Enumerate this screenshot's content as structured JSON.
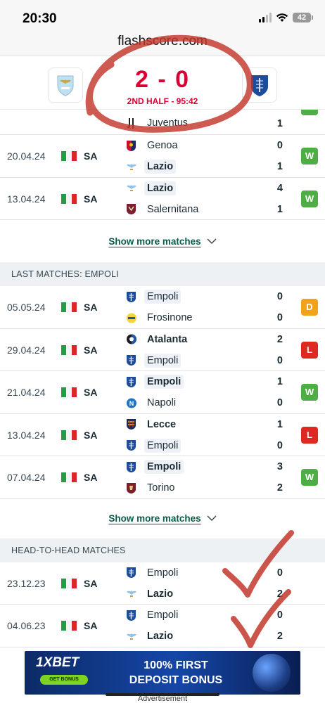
{
  "status_bar": {
    "time": "20:30",
    "battery": "42"
  },
  "browser": {
    "url": "flashscore.com"
  },
  "header": {
    "score": "2 - 0",
    "status": "2ND HALF - 95:42",
    "home_team": "lazio-crest",
    "away_team": "empoli-crest"
  },
  "lazio_matches": {
    "partial": {
      "home": "Juventus",
      "home_goals": "1",
      "result": "W"
    },
    "rows": [
      {
        "date": "20.04.24",
        "comp": "SA",
        "home": "Genoa",
        "away": "Lazio",
        "home_goals": "0",
        "away_goals": "1",
        "result": "W",
        "bold": "away",
        "hl": "away",
        "home_icon": "genoa",
        "away_icon": "lazio"
      },
      {
        "date": "13.04.24",
        "comp": "SA",
        "home": "Lazio",
        "away": "Salernitana",
        "home_goals": "4",
        "away_goals": "1",
        "result": "W",
        "bold": "home",
        "hl": "home",
        "home_icon": "lazio",
        "away_icon": "salernitana"
      }
    ],
    "show_more": "Show more matches"
  },
  "empoli_section": {
    "title": "LAST MATCHES: EMPOLI",
    "rows": [
      {
        "date": "05.05.24",
        "comp": "SA",
        "home": "Empoli",
        "away": "Frosinone",
        "home_goals": "0",
        "away_goals": "0",
        "result": "D",
        "bold": "none",
        "hl": "home",
        "home_icon": "empoli",
        "away_icon": "frosinone"
      },
      {
        "date": "29.04.24",
        "comp": "SA",
        "home": "Atalanta",
        "away": "Empoli",
        "home_goals": "2",
        "away_goals": "0",
        "result": "L",
        "bold": "home",
        "hl": "away",
        "home_icon": "atalanta",
        "away_icon": "empoli"
      },
      {
        "date": "21.04.24",
        "comp": "SA",
        "home": "Empoli",
        "away": "Napoli",
        "home_goals": "1",
        "away_goals": "0",
        "result": "W",
        "bold": "home",
        "hl": "home",
        "home_icon": "empoli",
        "away_icon": "napoli"
      },
      {
        "date": "13.04.24",
        "comp": "SA",
        "home": "Lecce",
        "away": "Empoli",
        "home_goals": "1",
        "away_goals": "0",
        "result": "L",
        "bold": "home",
        "hl": "away",
        "home_icon": "lecce",
        "away_icon": "empoli"
      },
      {
        "date": "07.04.24",
        "comp": "SA",
        "home": "Empoli",
        "away": "Torino",
        "home_goals": "3",
        "away_goals": "2",
        "result": "W",
        "bold": "home",
        "hl": "home",
        "home_icon": "empoli",
        "away_icon": "torino"
      }
    ],
    "show_more": "Show more matches"
  },
  "h2h_section": {
    "title": "HEAD-TO-HEAD MATCHES",
    "rows": [
      {
        "date": "23.12.23",
        "comp": "SA",
        "home": "Empoli",
        "away": "Lazio",
        "home_goals": "0",
        "away_goals": "2",
        "result": "",
        "bold": "away",
        "hl": "none",
        "home_icon": "empoli",
        "away_icon": "lazio"
      },
      {
        "date": "04.06.23",
        "comp": "SA",
        "home": "Empoli",
        "away": "Lazio",
        "home_goals": "0",
        "away_goals": "2",
        "result": "",
        "bold": "away",
        "hl": "none",
        "home_icon": "empoli",
        "away_icon": "lazio"
      }
    ]
  },
  "ad": {
    "brand": "1XBET",
    "cta": "GET BONUS",
    "line1": "100% FIRST",
    "line2": "DEPOSIT BONUS",
    "label": "Advertisement"
  },
  "colors": {
    "live_red": "#dc0032",
    "win": "#4eae45",
    "draw": "#f2a31c",
    "loss": "#dc2a22",
    "annotation": "#c2372c"
  }
}
